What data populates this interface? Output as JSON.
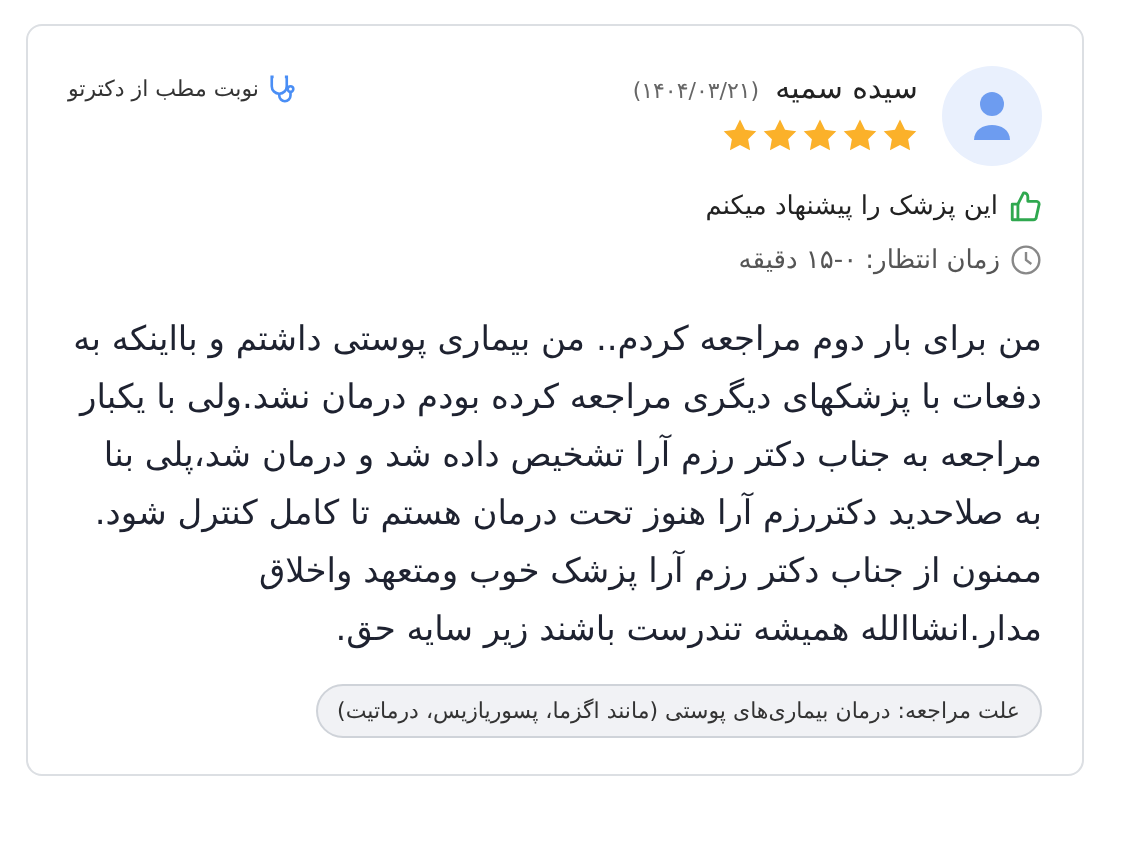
{
  "review": {
    "author": "سیده سمیه",
    "date": "(۱۴۰۴/۰۳/۲۱)",
    "stars": 5,
    "source": "نوبت مطب از دکترتو",
    "recommendation": "این پزشک را پیشنهاد میکنم",
    "wait_time": "زمان انتظار: ۰-۱۵ دقیقه",
    "body": "من برای بار دوم مراجعه کردم.. من بیماری پوستی داشتم و بااینکه به دفعات با پزشکهای دیگری مراجعه کرده بودم درمان نشد.ولی با یکبار مراجعه به جناب دکتر رزم آرا تشخیص داده شد و درمان شد،پلی بنا به صلاحدید دکتررزم آرا هنوز تحت درمان هستم تا کامل کنترل شود. ممنون از جناب دکتر رزم آرا پزشک خوب ومتعهد واخلاق مدار.انشاالله همیشه تندرست باشند زیر سایه حق.",
    "visit_reason": "علت مراجعه: درمان بیماری‌های پوستی (مانند اگزما، پسوریازیس، درماتیت)"
  }
}
